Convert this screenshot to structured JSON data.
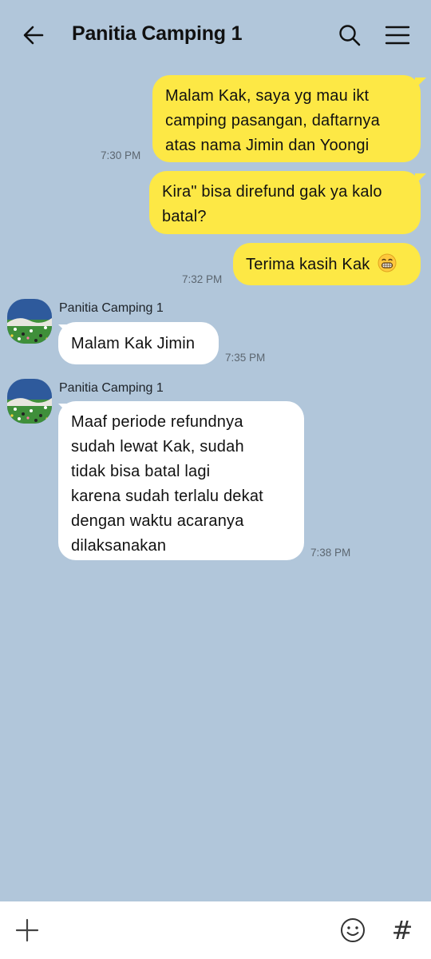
{
  "header": {
    "title": "Panitia Camping 1",
    "back_icon": "arrow-left-icon",
    "search_icon": "search-icon",
    "menu_icon": "hamburger-menu-icon"
  },
  "messages": [
    {
      "from": "me",
      "lines": [
        "Malam Kak, saya yg mau ikt",
        "camping pasangan, daftarnya",
        "atas nama Jimin dan Yoongi"
      ],
      "time": "7:30 PM"
    },
    {
      "from": "me",
      "lines": [
        "Kira\" bisa direfund gak ya kalo",
        "batal?"
      ],
      "time": ""
    },
    {
      "from": "me",
      "lines": [
        "Terima kasih Kak"
      ],
      "emoji": "grinning-face-icon",
      "time": "7:32 PM"
    },
    {
      "from": "them",
      "sender": "Panitia Camping 1",
      "lines": [
        "Malam Kak Jimin"
      ],
      "time": "7:35 PM"
    },
    {
      "from": "them",
      "sender": "Panitia Camping 1",
      "lines": [
        "Maaf periode refundnya",
        "sudah lewat Kak, sudah",
        "tidak bisa batal lagi",
        "karena sudah terlalu dekat",
        "dengan waktu acaranya",
        "dilaksanakan"
      ],
      "time": "7:38 PM"
    }
  ],
  "composer": {
    "plus_icon": "plus-icon",
    "emoji_icon": "emoticon-icon",
    "hash_label": "#"
  },
  "colors": {
    "background": "#b1c6da",
    "my_bubble": "#fde845",
    "their_bubble": "#ffffff",
    "time_text": "#5c6670"
  }
}
